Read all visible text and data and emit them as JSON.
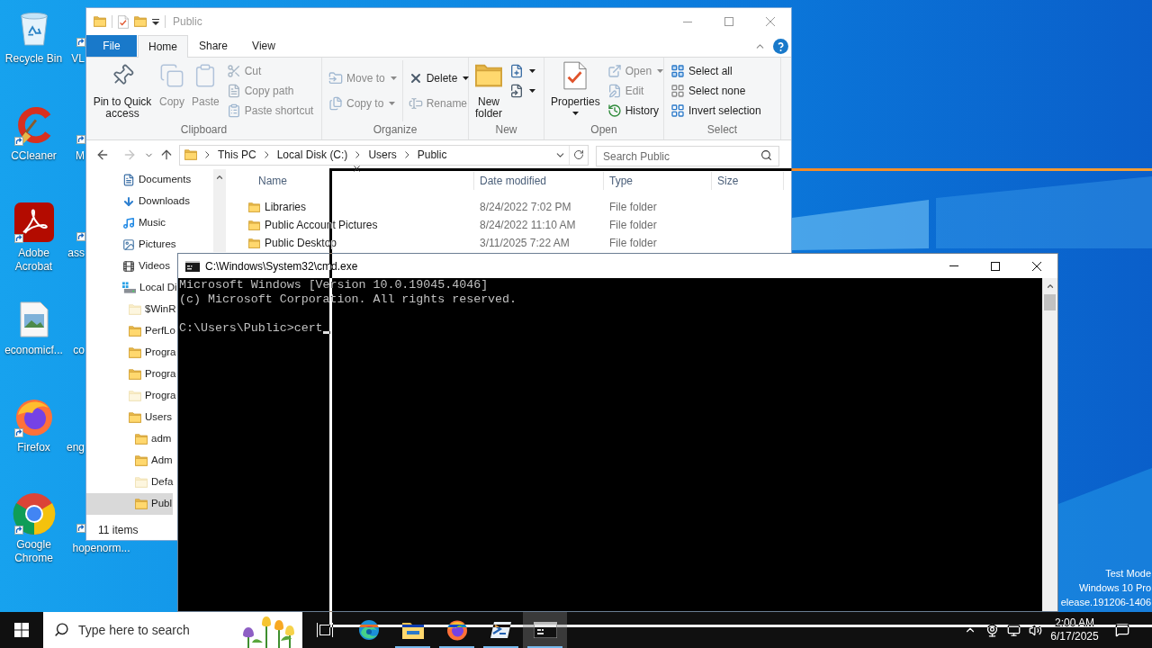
{
  "desktop": {
    "icons": [
      {
        "label": "Recycle Bin",
        "kind": "recycle-bin",
        "shortcut": false
      },
      {
        "label": "CCleaner",
        "kind": "ccleaner",
        "shortcut": true
      },
      {
        "label": "Adobe Acrobat",
        "kind": "acrobat",
        "shortcut": true
      },
      {
        "label": "economicf...",
        "kind": "image-file",
        "shortcut": false
      },
      {
        "label": "Firefox",
        "kind": "firefox",
        "shortcut": true
      },
      {
        "label": "Google Chrome",
        "kind": "chrome",
        "shortcut": true
      }
    ],
    "second_column": [
      {
        "label": "VL",
        "cut": true,
        "shortcut": true
      },
      {
        "label": "M",
        "cut": true,
        "shortcut": true
      },
      {
        "label": "ass",
        "cut": true,
        "shortcut": true
      },
      {
        "label": "co",
        "cut": true,
        "shortcut": false
      },
      {
        "label": "eng",
        "cut": true,
        "shortcut": false
      },
      {
        "label": "hopenorm...",
        "cut": false,
        "shortcut": true
      }
    ],
    "system_info": [
      "Test Mode",
      "Windows 10 Pro",
      "elease.191206-1406"
    ]
  },
  "explorer": {
    "title": "Public",
    "active": false,
    "tabs": [
      {
        "label": "File",
        "kind": "file",
        "selected": false
      },
      {
        "label": "Home",
        "kind": "tab",
        "selected": true
      },
      {
        "label": "Share",
        "kind": "tab",
        "selected": false
      },
      {
        "label": "View",
        "kind": "tab",
        "selected": false
      }
    ],
    "ribbon": [
      {
        "label": "Clipboard",
        "columns": [
          [
            {
              "label": "Pin to Quick access",
              "kind": "pin",
              "disabled": false,
              "dropdown": false
            }
          ],
          [
            {
              "label": "Copy",
              "kind": "copy",
              "disabled": true,
              "dropdown": false
            }
          ],
          [
            {
              "label": "Paste",
              "kind": "paste",
              "disabled": true,
              "dropdown": false
            }
          ],
          [
            {
              "label": "Cut",
              "kind": "cut",
              "disabled": true,
              "dropdown": false
            },
            {
              "label": "Copy path",
              "kind": "copy-path",
              "disabled": true,
              "dropdown": false
            },
            {
              "label": "Paste shortcut",
              "kind": "paste-shortcut",
              "disabled": true,
              "dropdown": false
            }
          ]
        ]
      },
      {
        "label": "Organize",
        "columns": [
          [
            {
              "label": "Move to",
              "kind": "move-to",
              "disabled": true,
              "dropdown": true
            },
            {
              "label": "Copy to",
              "kind": "copy-to",
              "disabled": true,
              "dropdown": true
            }
          ],
          [
            {
              "label": "Delete",
              "kind": "delete",
              "disabled": false,
              "dropdown": true
            },
            {
              "label": "Rename",
              "kind": "rename",
              "disabled": true,
              "dropdown": false
            }
          ]
        ]
      },
      {
        "label": "New",
        "columns": [
          [
            {
              "label": "New folder",
              "kind": "new-folder",
              "disabled": false,
              "dropdown": false
            }
          ],
          [
            {
              "kind": "new-item",
              "disabled": false,
              "dropdown": true
            },
            {
              "kind": "easy-access",
              "disabled": false,
              "dropdown": true
            }
          ]
        ]
      },
      {
        "label": "Open",
        "columns": [
          [
            {
              "label": "Properties",
              "kind": "properties",
              "disabled": false,
              "dropdown": true
            }
          ],
          [
            {
              "label": "Open",
              "kind": "open",
              "disabled": true,
              "dropdown": true
            },
            {
              "label": "Edit",
              "kind": "edit",
              "disabled": true,
              "dropdown": false
            },
            {
              "label": "History",
              "kind": "history",
              "disabled": false,
              "dropdown": false
            }
          ]
        ]
      },
      {
        "label": "Select",
        "columns": [
          [
            {
              "label": "Select all",
              "kind": "select-all",
              "disabled": false,
              "dropdown": false
            },
            {
              "label": "Select none",
              "kind": "select-none",
              "disabled": false,
              "dropdown": false
            },
            {
              "label": "Invert selection",
              "kind": "invert",
              "disabled": false,
              "dropdown": false
            }
          ]
        ]
      }
    ],
    "nav_buttons": [
      {
        "kind": "back",
        "disabled": false
      },
      {
        "kind": "forward",
        "disabled": true
      },
      {
        "kind": "recent",
        "disabled": false
      },
      {
        "kind": "up",
        "disabled": false
      }
    ],
    "path": [
      "This PC",
      "Local Disk (C:)",
      "Users",
      "Public"
    ],
    "search": {
      "placeholder": "Search Public"
    },
    "navigation": [
      {
        "label": "Documents",
        "kind": "documents",
        "selected": false
      },
      {
        "label": "Downloads",
        "kind": "downloads",
        "selected": false
      },
      {
        "label": "Music",
        "kind": "music",
        "selected": false
      },
      {
        "label": "Pictures",
        "kind": "pictures",
        "selected": false
      },
      {
        "label": "Videos",
        "kind": "videos",
        "selected": false
      },
      {
        "label": "Local Di",
        "kind": "drive",
        "selected": false,
        "children": [
          {
            "label": "$WinR",
            "kind": "folder",
            "hidden": true,
            "selected": false
          },
          {
            "label": "PerfLo",
            "kind": "folder",
            "hidden": false,
            "selected": false
          },
          {
            "label": "Progra",
            "kind": "folder",
            "hidden": false,
            "selected": false
          },
          {
            "label": "Progra",
            "kind": "folder",
            "hidden": false,
            "selected": false
          },
          {
            "label": "Progra",
            "kind": "folder",
            "hidden": true,
            "selected": false
          },
          {
            "label": "Users",
            "kind": "folder",
            "hidden": false,
            "selected": false,
            "children": [
              {
                "label": "adm",
                "kind": "folder",
                "hidden": false,
                "selected": false
              },
              {
                "label": "Adm",
                "kind": "folder",
                "hidden": false,
                "selected": false
              },
              {
                "label": "Defa",
                "kind": "folder",
                "hidden": true,
                "selected": false
              },
              {
                "label": "Publ",
                "kind": "folder",
                "hidden": false,
                "selected": true
              }
            ]
          }
        ]
      }
    ],
    "columns": [
      "Name",
      "Date modified",
      "Type",
      "Size"
    ],
    "rows": [
      {
        "name": "Libraries",
        "date_modified": "8/24/2022 7:02 PM",
        "type": "File folder"
      },
      {
        "name": "Public Account Pictures",
        "date_modified": "8/24/2022 11:10 AM",
        "type": "File folder"
      },
      {
        "name": "Public Desktop",
        "date_modified": "3/11/2025 7:22 AM",
        "type": "File folder"
      }
    ],
    "status": "11 items"
  },
  "cmd": {
    "title": "C:\\Windows\\System32\\cmd.exe",
    "active": true,
    "output": [
      "Microsoft Windows [Version 10.0.19045.4046]",
      "(c) Microsoft Corporation. All rights reserved."
    ],
    "prompt": "C:\\Users\\Public>cert"
  },
  "taskbar": {
    "search": {
      "placeholder": "Type here to search"
    },
    "apps": [
      {
        "kind": "browser-wave",
        "running": false,
        "selected": false
      },
      {
        "kind": "folder",
        "running": true,
        "selected": false
      },
      {
        "kind": "browser-fox",
        "running": true,
        "selected": false
      },
      {
        "kind": "terminal",
        "running": true,
        "selected": false
      },
      {
        "kind": "console",
        "running": true,
        "selected": true
      }
    ],
    "time": "2:00 AM",
    "date": "6/17/2025"
  }
}
